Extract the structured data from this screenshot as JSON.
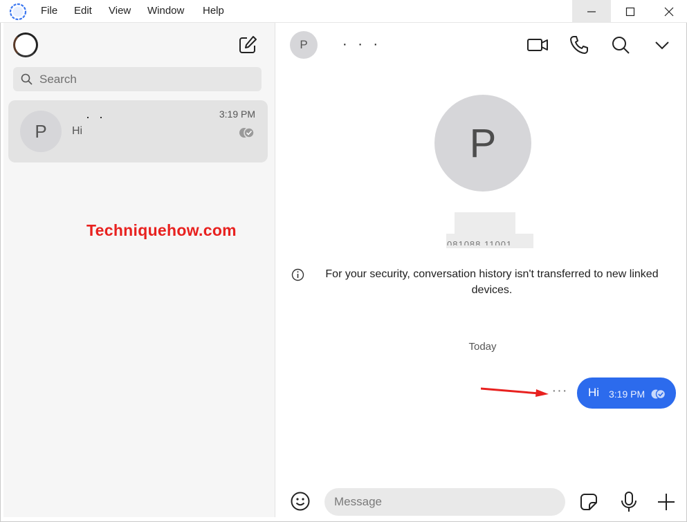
{
  "menubar": {
    "items": [
      "File",
      "Edit",
      "View",
      "Window",
      "Help"
    ]
  },
  "sidebar": {
    "search": {
      "placeholder": "Search"
    },
    "conversations": [
      {
        "avatar_letter": "P",
        "name": "· ·",
        "snippet": "Hi",
        "time": "3:19 PM"
      }
    ]
  },
  "watermark": "Techniquehow.com",
  "chat": {
    "header": {
      "avatar_letter": "P",
      "name": "· · ·"
    },
    "profile": {
      "avatar_letter": "P",
      "redacted_phone": "081088 11001"
    },
    "security_notice": "For your security, conversation history isn't transferred to new linked devices.",
    "date_separator": "Today",
    "messages": [
      {
        "text": "Hi",
        "time": "3:19 PM",
        "outgoing": true
      }
    ],
    "more_actions": "···",
    "composer": {
      "placeholder": "Message"
    }
  },
  "colors": {
    "accent": "#2c6bed",
    "watermark": "#e8211f",
    "arrow": "#e8211f"
  },
  "icons": [
    "signal-logo-icon",
    "compose-icon",
    "search-icon",
    "video-call-icon",
    "phone-icon",
    "chevron-down-icon",
    "info-icon",
    "delivered-check-icon",
    "emoji-icon",
    "sticker-icon",
    "microphone-icon",
    "plus-icon"
  ]
}
